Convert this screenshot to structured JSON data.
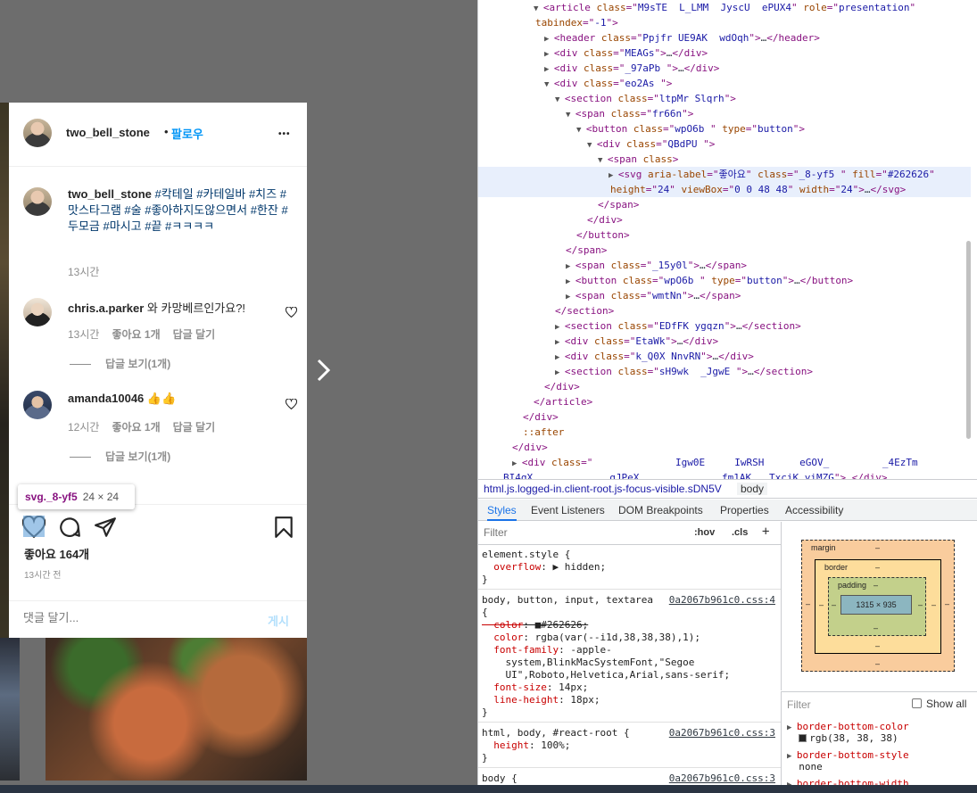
{
  "post": {
    "username": "two_bell_stone",
    "follow_dot": "•",
    "follow_label": "팔로우",
    "more_label": "•••",
    "caption_tags": "#칵테일 #카테일바 #치즈 #맛스타그램 #술 #좋아하지도않으면서 #한잔 #두모금 #마시고 #끝 #ㅋㅋㅋㅋ",
    "caption_time": "13시간",
    "comments": [
      {
        "user": "chris.a.parker",
        "text": "와 카망베르인가요?!",
        "time": "13시간",
        "likes": "좋아요 1개",
        "reply": "답글 달기",
        "view_replies": "답글 보기(1개)"
      },
      {
        "user": "amanda10046",
        "text": "👍👍",
        "time": "12시간",
        "likes": "좋아요 1개",
        "reply": "답글 달기",
        "view_replies": "답글 보기(1개)"
      }
    ],
    "likes_count": "좋아요 164개",
    "time_ago": "13시간 전",
    "comment_placeholder": "댓글 달기...",
    "post_button": "게시"
  },
  "tooltip": {
    "name": "svg._8-yf5",
    "size": "24 × 24"
  },
  "devtools": {
    "elements": [
      {
        "tri": "▼",
        "parts": [
          [
            "tag",
            "<article "
          ],
          [
            "attr",
            "class"
          ],
          [
            "tag",
            "=\""
          ],
          [
            "val",
            "M9sTE  L_LMM  JyscU  ePUX4"
          ],
          [
            "tag",
            "\" "
          ],
          [
            "attr",
            "role"
          ],
          [
            "tag",
            "=\""
          ],
          [
            "val",
            "presentation"
          ],
          [
            "tag",
            "\""
          ]
        ]
      },
      {
        "tri": "",
        "parts": [
          [
            "attr",
            "tabindex"
          ],
          [
            "tag",
            "=\""
          ],
          [
            "val",
            "-1"
          ],
          [
            "tag",
            "\">"
          ]
        ]
      },
      {
        "tri": "▶",
        "parts": [
          [
            "tag",
            "<header "
          ],
          [
            "attr",
            "class"
          ],
          [
            "tag",
            "=\""
          ],
          [
            "val",
            "Ppjfr UE9AK  wdOqh"
          ],
          [
            "tag",
            "\">"
          ],
          [
            "txt",
            "…"
          ],
          [
            "tag",
            "</header>"
          ]
        ]
      },
      {
        "tri": "▶",
        "parts": [
          [
            "tag",
            "<div "
          ],
          [
            "attr",
            "class"
          ],
          [
            "tag",
            "=\""
          ],
          [
            "val",
            "MEAGs"
          ],
          [
            "tag",
            "\">"
          ],
          [
            "txt",
            "…"
          ],
          [
            "tag",
            "</div>"
          ]
        ]
      },
      {
        "tri": "▶",
        "parts": [
          [
            "tag",
            "<div "
          ],
          [
            "attr",
            "class"
          ],
          [
            "tag",
            "=\""
          ],
          [
            "val",
            "_97aPb "
          ],
          [
            "tag",
            "\">"
          ],
          [
            "txt",
            "…"
          ],
          [
            "tag",
            "</div>"
          ]
        ]
      },
      {
        "tri": "▼",
        "parts": [
          [
            "tag",
            "<div "
          ],
          [
            "attr",
            "class"
          ],
          [
            "tag",
            "=\""
          ],
          [
            "val",
            "eo2As "
          ],
          [
            "tag",
            "\">"
          ]
        ]
      },
      {
        "tri": "▼",
        "parts": [
          [
            "tag",
            "<section "
          ],
          [
            "attr",
            "class"
          ],
          [
            "tag",
            "=\""
          ],
          [
            "val",
            "ltpMr Slqrh"
          ],
          [
            "tag",
            "\">"
          ]
        ]
      },
      {
        "tri": "▼",
        "parts": [
          [
            "tag",
            "<span "
          ],
          [
            "attr",
            "class"
          ],
          [
            "tag",
            "=\""
          ],
          [
            "val",
            "fr66n"
          ],
          [
            "tag",
            "\">"
          ]
        ]
      },
      {
        "tri": "▼",
        "parts": [
          [
            "tag",
            "<button "
          ],
          [
            "attr",
            "class"
          ],
          [
            "tag",
            "=\""
          ],
          [
            "val",
            "wpO6b "
          ],
          [
            "tag",
            "\" "
          ],
          [
            "attr",
            "type"
          ],
          [
            "tag",
            "=\""
          ],
          [
            "val",
            "button"
          ],
          [
            "tag",
            "\">"
          ]
        ]
      },
      {
        "tri": "▼",
        "parts": [
          [
            "tag",
            "<div "
          ],
          [
            "attr",
            "class"
          ],
          [
            "tag",
            "=\""
          ],
          [
            "val",
            "QBdPU "
          ],
          [
            "tag",
            "\">"
          ]
        ]
      },
      {
        "tri": "▼",
        "parts": [
          [
            "tag",
            "<span "
          ],
          [
            "attr",
            "class"
          ],
          [
            "tag",
            ">"
          ]
        ]
      },
      {
        "tri": "▶",
        "parts": [
          [
            "tag",
            "<svg "
          ],
          [
            "attr",
            "aria-label"
          ],
          [
            "tag",
            "=\""
          ],
          [
            "val",
            "좋아요"
          ],
          [
            "tag",
            "\" "
          ],
          [
            "attr",
            "class"
          ],
          [
            "tag",
            "=\""
          ],
          [
            "val",
            "_8-yf5 "
          ],
          [
            "tag",
            "\" "
          ],
          [
            "attr",
            "fill"
          ],
          [
            "tag",
            "=\""
          ],
          [
            "val",
            "#262626"
          ],
          [
            "tag",
            "\""
          ]
        ]
      },
      {
        "tri": "",
        "parts": [
          [
            "attr",
            "height"
          ],
          [
            "tag",
            "=\""
          ],
          [
            "val",
            "24"
          ],
          [
            "tag",
            "\" "
          ],
          [
            "attr",
            "viewBox"
          ],
          [
            "tag",
            "=\""
          ],
          [
            "val",
            "0 0 48 48"
          ],
          [
            "tag",
            "\" "
          ],
          [
            "attr",
            "width"
          ],
          [
            "tag",
            "=\""
          ],
          [
            "val",
            "24"
          ],
          [
            "tag",
            "\">"
          ],
          [
            "txt",
            "…"
          ],
          [
            "tag",
            "</svg>"
          ]
        ]
      },
      {
        "tri": "",
        "parts": [
          [
            "tag",
            "</span>"
          ]
        ]
      },
      {
        "tri": "",
        "parts": [
          [
            "tag",
            "</div>"
          ]
        ]
      },
      {
        "tri": "",
        "parts": [
          [
            "tag",
            "</button>"
          ]
        ]
      },
      {
        "tri": "",
        "parts": [
          [
            "tag",
            "</span>"
          ]
        ]
      },
      {
        "tri": "▶",
        "parts": [
          [
            "tag",
            "<span "
          ],
          [
            "attr",
            "class"
          ],
          [
            "tag",
            "=\""
          ],
          [
            "val",
            "_15y0l"
          ],
          [
            "tag",
            "\">"
          ],
          [
            "txt",
            "…"
          ],
          [
            "tag",
            "</span>"
          ]
        ]
      },
      {
        "tri": "▶",
        "parts": [
          [
            "tag",
            "<button "
          ],
          [
            "attr",
            "class"
          ],
          [
            "tag",
            "=\""
          ],
          [
            "val",
            "wpO6b "
          ],
          [
            "tag",
            "\" "
          ],
          [
            "attr",
            "type"
          ],
          [
            "tag",
            "=\""
          ],
          [
            "val",
            "button"
          ],
          [
            "tag",
            "\">"
          ],
          [
            "txt",
            "…"
          ],
          [
            "tag",
            "</button>"
          ]
        ]
      },
      {
        "tri": "▶",
        "parts": [
          [
            "tag",
            "<span "
          ],
          [
            "attr",
            "class"
          ],
          [
            "tag",
            "=\""
          ],
          [
            "val",
            "wmtNn"
          ],
          [
            "tag",
            "\">"
          ],
          [
            "txt",
            "…"
          ],
          [
            "tag",
            "</span>"
          ]
        ]
      },
      {
        "tri": "",
        "parts": [
          [
            "tag",
            "</section>"
          ]
        ]
      },
      {
        "tri": "▶",
        "parts": [
          [
            "tag",
            "<section "
          ],
          [
            "attr",
            "class"
          ],
          [
            "tag",
            "=\""
          ],
          [
            "val",
            "EDfFK ygqzn"
          ],
          [
            "tag",
            "\">"
          ],
          [
            "txt",
            "…"
          ],
          [
            "tag",
            "</section>"
          ]
        ]
      },
      {
        "tri": "▶",
        "parts": [
          [
            "tag",
            "<div "
          ],
          [
            "attr",
            "class"
          ],
          [
            "tag",
            "=\""
          ],
          [
            "val",
            "EtaWk"
          ],
          [
            "tag",
            "\">"
          ],
          [
            "txt",
            "…"
          ],
          [
            "tag",
            "</div>"
          ]
        ]
      },
      {
        "tri": "▶",
        "parts": [
          [
            "tag",
            "<div "
          ],
          [
            "attr",
            "class"
          ],
          [
            "tag",
            "=\""
          ],
          [
            "val",
            "k_Q0X NnvRN"
          ],
          [
            "tag",
            "\">"
          ],
          [
            "txt",
            "…"
          ],
          [
            "tag",
            "</div>"
          ]
        ]
      },
      {
        "tri": "▶",
        "parts": [
          [
            "tag",
            "<section "
          ],
          [
            "attr",
            "class"
          ],
          [
            "tag",
            "=\""
          ],
          [
            "val",
            "sH9wk  _JgwE "
          ],
          [
            "tag",
            "\">"
          ],
          [
            "txt",
            "…"
          ],
          [
            "tag",
            "</section>"
          ]
        ]
      },
      {
        "tri": "",
        "parts": [
          [
            "tag",
            "</div>"
          ]
        ]
      },
      {
        "tri": "",
        "parts": [
          [
            "tag",
            "</article>"
          ]
        ]
      },
      {
        "tri": "",
        "parts": [
          [
            "tag",
            "</div>"
          ]
        ]
      },
      {
        "tri": "",
        "parts": [
          [
            "attr",
            "::after"
          ]
        ]
      },
      {
        "tri": "",
        "parts": [
          [
            "tag",
            "</div>"
          ]
        ]
      },
      {
        "tri": "▶",
        "parts": [
          [
            "tag",
            "<div "
          ],
          [
            "attr",
            "class"
          ],
          [
            "tag",
            "=\""
          ],
          [
            "val",
            "              Igw0E     IwRSH      eGOV_         _4EzTm"
          ],
          [
            "tag",
            ""
          ]
        ]
      },
      {
        "tri": "",
        "parts": [
          [
            "val",
            "BI4qX             qJPeX              fm1AK   TxciK yiMZG"
          ],
          [
            "tag",
            "\">"
          ],
          [
            "txt",
            "…"
          ],
          [
            "tag",
            "</div>"
          ]
        ]
      }
    ],
    "breadcrumb_path": "html.js.logged-in.client-root.js-focus-visible.sDN5V",
    "breadcrumb_body": "body",
    "tabs": [
      "Styles",
      "Event Listeners",
      "DOM Breakpoints",
      "Properties",
      "Accessibility"
    ],
    "filter_placeholder": "Filter",
    "hov": ":hov",
    "cls": ".cls",
    "plus": "+",
    "rules": [
      {
        "selector": "element.style {",
        "source": "",
        "props": [
          {
            "name": "overflow",
            "value": "▶ hidden;",
            "strike": false
          }
        ],
        "close": "}"
      },
      {
        "selector": "body, button, input, textarea",
        "source": "0a2067b961c0.css:4",
        "open": "{",
        "props": [
          {
            "name": "color",
            "value": "■#262626;",
            "strike": true
          },
          {
            "name": "color",
            "value": "rgba(var(--i1d,38,38,38),1);",
            "strike": false
          },
          {
            "name": "font-family",
            "value": "-apple-",
            "strike": false
          },
          {
            "name": "",
            "value": "system,BlinkMacSystemFont,\"Segoe",
            "strike": false
          },
          {
            "name": "",
            "value": "UI\",Roboto,Helvetica,Arial,sans-serif;",
            "strike": false
          },
          {
            "name": "font-size",
            "value": "14px;",
            "strike": false
          },
          {
            "name": "line-height",
            "value": "18px;",
            "strike": false
          }
        ],
        "close": "}"
      },
      {
        "selector": "html, body, #react-root {",
        "source": "0a2067b961c0.css:3",
        "props": [
          {
            "name": "height",
            "value": "100%;",
            "strike": false
          }
        ],
        "close": "}"
      },
      {
        "selector": "body {",
        "source": "0a2067b961c0.css:3",
        "props": [],
        "close": ""
      }
    ],
    "box_model": {
      "margin": "margin",
      "border": "border",
      "padding": "padding",
      "content": "1315 × 935",
      "dash": "–"
    },
    "computed": {
      "filter_placeholder": "Filter",
      "show_all": "Show all",
      "props": [
        {
          "name": "border-bottom-color",
          "value": "rgb(38, 38, 38)",
          "swatch": "#262626"
        },
        {
          "name": "border-bottom-style",
          "value": "none"
        },
        {
          "name": "border-bottom-width",
          "value": ""
        }
      ]
    }
  }
}
